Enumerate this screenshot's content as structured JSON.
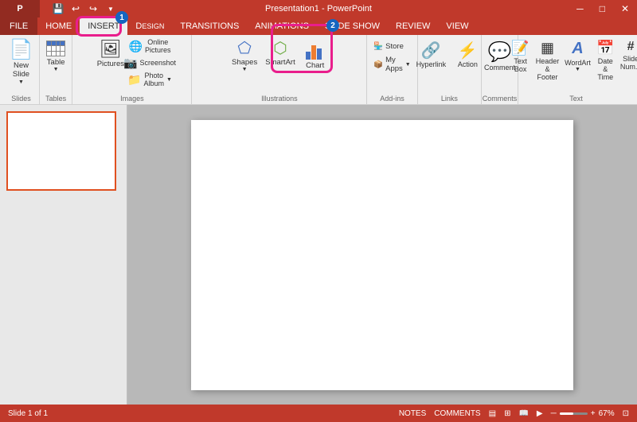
{
  "titlebar": {
    "title": "Presentation1 - PowerPoint",
    "window_controls": [
      "minimize",
      "maximize",
      "close"
    ]
  },
  "quickaccess": {
    "save_label": "💾",
    "undo_label": "↩",
    "redo_label": "↪"
  },
  "tabs": [
    {
      "id": "file",
      "label": "FILE"
    },
    {
      "id": "home",
      "label": "HOME"
    },
    {
      "id": "insert",
      "label": "INSERT",
      "active": true
    },
    {
      "id": "design",
      "label": "DESIGN"
    },
    {
      "id": "transitions",
      "label": "TRANSITIONS"
    },
    {
      "id": "animations",
      "label": "ANIMATIONS"
    },
    {
      "id": "slideshow",
      "label": "SLIDE SHOW"
    },
    {
      "id": "review",
      "label": "REVIEW"
    },
    {
      "id": "view",
      "label": "VIEW"
    }
  ],
  "ribbon": {
    "groups": [
      {
        "id": "slides",
        "label": "Slides",
        "items": [
          {
            "id": "new-slide",
            "label": "New\nSlide",
            "icon": "📄"
          }
        ]
      },
      {
        "id": "tables",
        "label": "Tables",
        "items": [
          {
            "id": "table",
            "label": "Table",
            "icon": "table"
          }
        ]
      },
      {
        "id": "images",
        "label": "Images",
        "items": [
          {
            "id": "pictures",
            "label": "Pictures",
            "icon": "🖼"
          },
          {
            "id": "online-pictures",
            "label": "Online\nPictures",
            "icon": "🌐"
          },
          {
            "id": "screenshot",
            "label": "Screenshot",
            "icon": "📷"
          },
          {
            "id": "photo-album",
            "label": "Photo\nAlbum",
            "icon": "📁"
          }
        ]
      },
      {
        "id": "illustrations",
        "label": "Illustrations",
        "items": [
          {
            "id": "shapes",
            "label": "Shapes",
            "icon": "shapes"
          },
          {
            "id": "smartart",
            "label": "SmartArt",
            "icon": "smartart"
          },
          {
            "id": "chart",
            "label": "Chart",
            "icon": "chart"
          }
        ]
      },
      {
        "id": "addins",
        "label": "Add-ins",
        "items": [
          {
            "id": "store",
            "label": "Store",
            "icon": "🏪"
          },
          {
            "id": "my-apps",
            "label": "My Apps",
            "icon": "📦"
          }
        ]
      },
      {
        "id": "links",
        "label": "Links",
        "items": [
          {
            "id": "hyperlink",
            "label": "Hyperlink",
            "icon": "🔗"
          },
          {
            "id": "action",
            "label": "Action",
            "icon": "⚡"
          }
        ]
      },
      {
        "id": "comments",
        "label": "Comments",
        "items": [
          {
            "id": "comment",
            "label": "Comment",
            "icon": "💬"
          }
        ]
      },
      {
        "id": "text",
        "label": "Text",
        "items": [
          {
            "id": "text-box",
            "label": "Text\nBox",
            "icon": "📝"
          },
          {
            "id": "header-footer",
            "label": "Header\n& Footer",
            "icon": "▦"
          },
          {
            "id": "wordart",
            "label": "WordArt",
            "icon": "A"
          },
          {
            "id": "date-time",
            "label": "Date &\nTime",
            "icon": "📅"
          },
          {
            "id": "slide-num",
            "label": "Slide\nNum...",
            "icon": "#"
          }
        ]
      }
    ]
  },
  "annotations": {
    "badge1": "1",
    "badge2": "2"
  },
  "slide": {
    "number": "1"
  },
  "statusbar": {
    "slide_info": "Slide 1 of 1",
    "notes": "NOTES",
    "comments_btn": "COMMENTS"
  }
}
